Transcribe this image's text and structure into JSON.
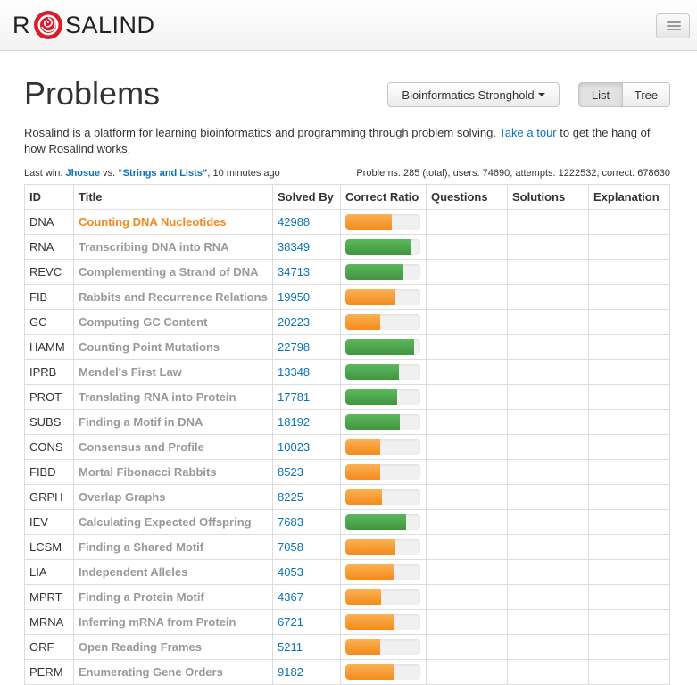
{
  "brand": {
    "name_left": "R",
    "name_right": "SALIND"
  },
  "header": {
    "title": "Problems",
    "area_button": "Bioinformatics Stronghold",
    "view_list": "List",
    "view_tree": "Tree"
  },
  "intro": {
    "text_before": "Rosalind is a platform for learning bioinformatics and programming through problem solving. ",
    "link": "Take a tour",
    "text_after": " to get the hang of how Rosalind works."
  },
  "lastwin": {
    "prefix": "Last win: ",
    "user": "Jhosue",
    "vs": " vs. ",
    "problem": "“Strings and Lists”",
    "time": ", 10 minutes ago"
  },
  "stats": "Problems: 285 (total), users: 74690, attempts: 1222532, correct: 678630",
  "table": {
    "columns": [
      "ID",
      "Title",
      "Solved By",
      "Correct Ratio",
      "Questions",
      "Solutions",
      "Explanation"
    ],
    "rows": [
      {
        "id": "DNA",
        "title": "Counting DNA Nucleotides",
        "solved": "42988",
        "ratio": 0.62,
        "color": "orange",
        "current": true
      },
      {
        "id": "RNA",
        "title": "Transcribing DNA into RNA",
        "solved": "38349",
        "ratio": 0.87,
        "color": "green"
      },
      {
        "id": "REVC",
        "title": "Complementing a Strand of DNA",
        "solved": "34713",
        "ratio": 0.77,
        "color": "green"
      },
      {
        "id": "FIB",
        "title": "Rabbits and Recurrence Relations",
        "solved": "19950",
        "ratio": 0.67,
        "color": "orange"
      },
      {
        "id": "GC",
        "title": "Computing GC Content",
        "solved": "20223",
        "ratio": 0.47,
        "color": "orange"
      },
      {
        "id": "HAMM",
        "title": "Counting Point Mutations",
        "solved": "22798",
        "ratio": 0.92,
        "color": "green"
      },
      {
        "id": "IPRB",
        "title": "Mendel's First Law",
        "solved": "13348",
        "ratio": 0.71,
        "color": "green"
      },
      {
        "id": "PROT",
        "title": "Translating RNA into Protein",
        "solved": "17781",
        "ratio": 0.69,
        "color": "green"
      },
      {
        "id": "SUBS",
        "title": "Finding a Motif in DNA",
        "solved": "18192",
        "ratio": 0.73,
        "color": "green"
      },
      {
        "id": "CONS",
        "title": "Consensus and Profile",
        "solved": "10023",
        "ratio": 0.46,
        "color": "orange"
      },
      {
        "id": "FIBD",
        "title": "Mortal Fibonacci Rabbits",
        "solved": "8523",
        "ratio": 0.46,
        "color": "orange"
      },
      {
        "id": "GRPH",
        "title": "Overlap Graphs",
        "solved": "8225",
        "ratio": 0.49,
        "color": "orange"
      },
      {
        "id": "IEV",
        "title": "Calculating Expected Offspring",
        "solved": "7683",
        "ratio": 0.81,
        "color": "green"
      },
      {
        "id": "LCSM",
        "title": "Finding a Shared Motif",
        "solved": "7058",
        "ratio": 0.67,
        "color": "orange"
      },
      {
        "id": "LIA",
        "title": "Independent Alleles",
        "solved": "4053",
        "ratio": 0.65,
        "color": "orange"
      },
      {
        "id": "MPRT",
        "title": "Finding a Protein Motif",
        "solved": "4367",
        "ratio": 0.48,
        "color": "orange"
      },
      {
        "id": "MRNA",
        "title": "Inferring mRNA from Protein",
        "solved": "6721",
        "ratio": 0.65,
        "color": "orange"
      },
      {
        "id": "ORF",
        "title": "Open Reading Frames",
        "solved": "5211",
        "ratio": 0.46,
        "color": "orange"
      },
      {
        "id": "PERM",
        "title": "Enumerating Gene Orders",
        "solved": "9182",
        "ratio": 0.66,
        "color": "orange"
      }
    ]
  }
}
